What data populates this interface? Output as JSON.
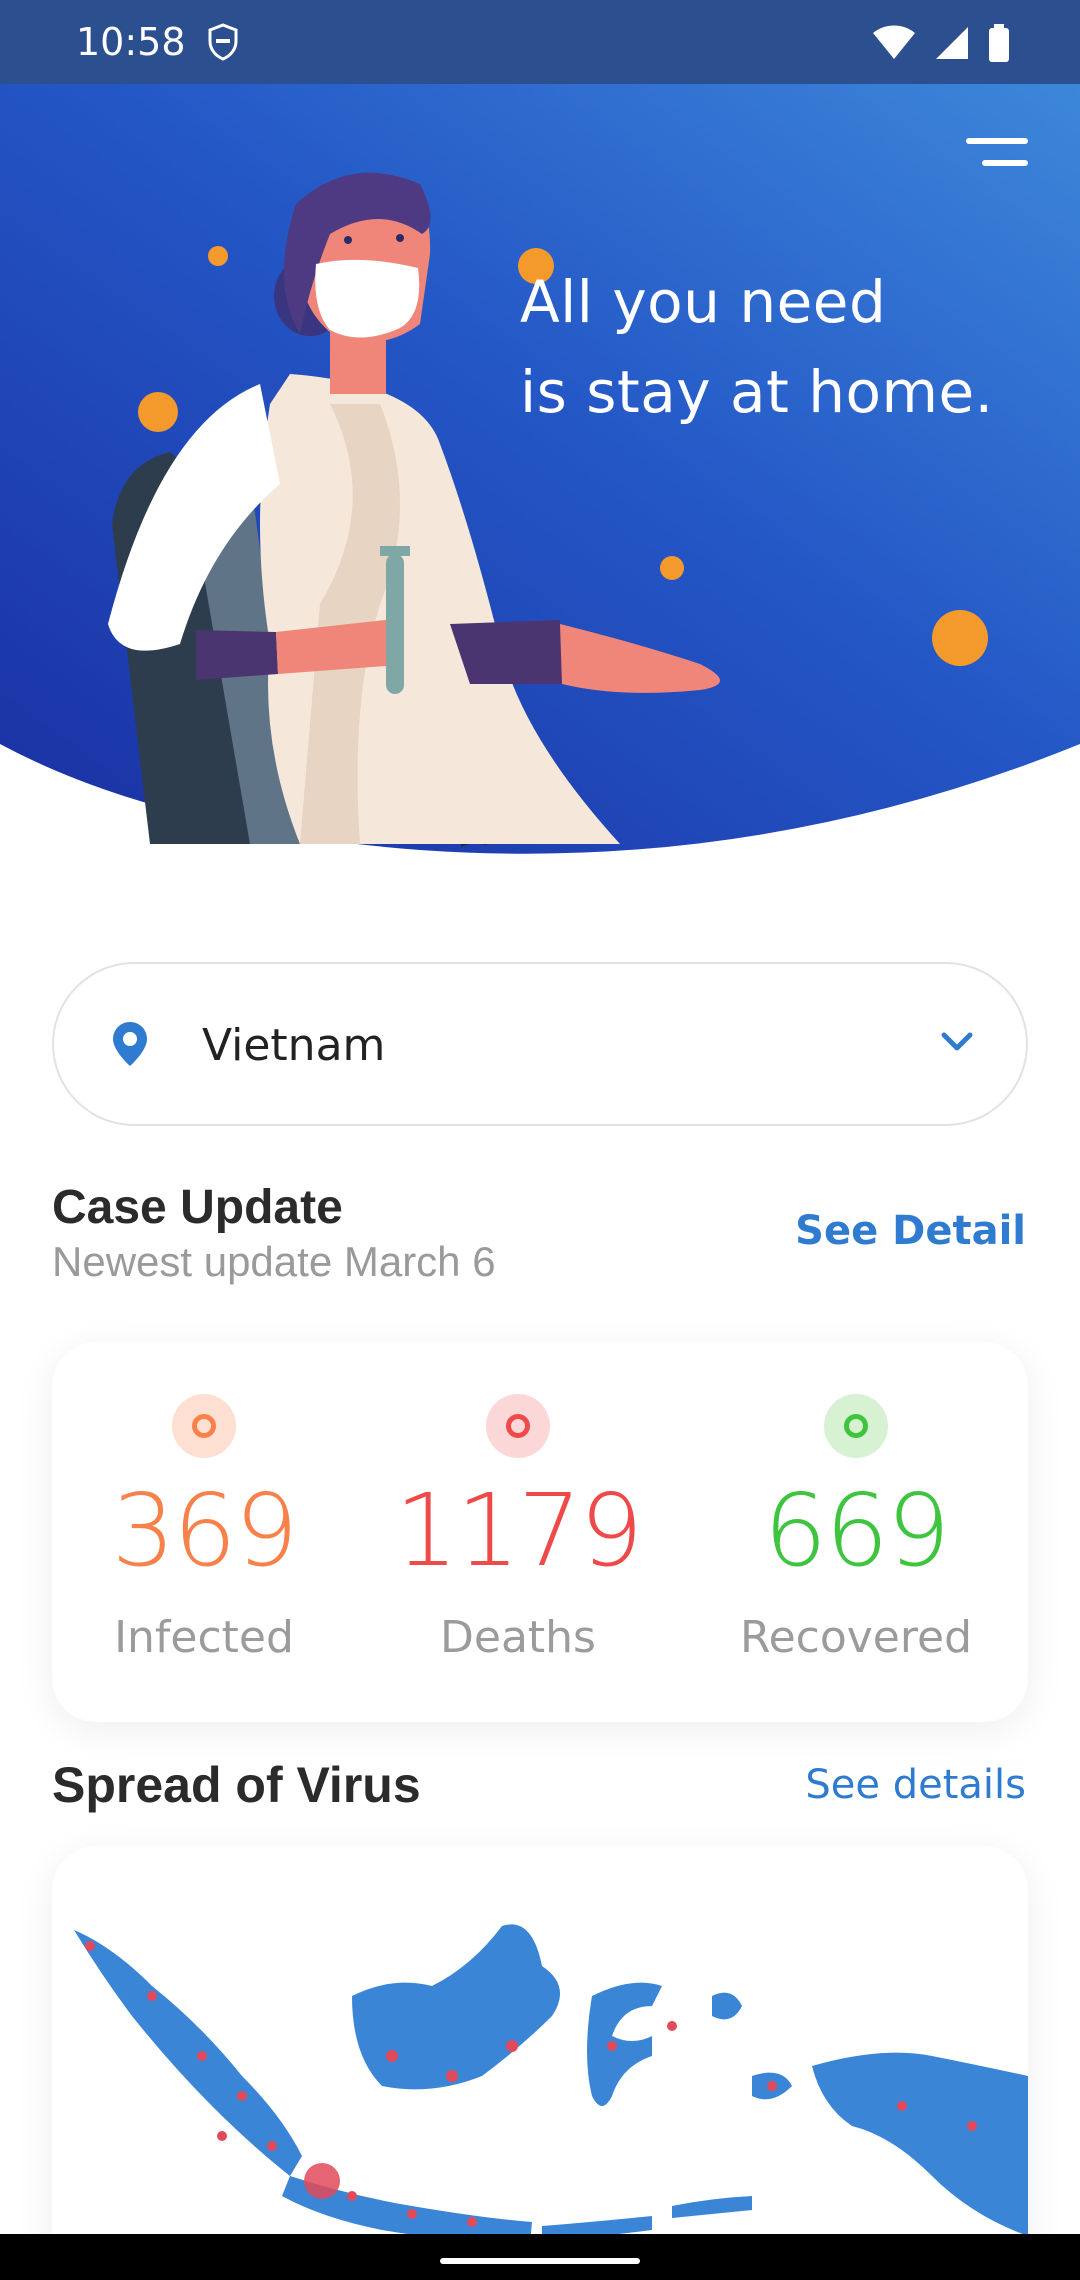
{
  "status_bar": {
    "time": "10:58"
  },
  "hero": {
    "line1": "All you need",
    "line2": "is stay at home.",
    "gradient_start": "#1b36a8",
    "gradient_end": "#3b82d8"
  },
  "location": {
    "selected": "Vietnam"
  },
  "case_update": {
    "title": "Case Update",
    "subtitle": "Newest update March 6",
    "link": "See Detail",
    "stats": [
      {
        "value": "369",
        "label": "Infected",
        "color": "#f6814a",
        "dot_bg": "#fde0d2"
      },
      {
        "value": "1179",
        "label": "Deaths",
        "color": "#ef4a4a",
        "dot_bg": "#fbd7d7"
      },
      {
        "value": "669",
        "label": "Recovered",
        "color": "#3ec43e",
        "dot_bg": "#d6f2d3"
      }
    ]
  },
  "spread": {
    "title": "Spread of Virus",
    "link": "See details",
    "map_color": "#3a85d6",
    "marker_color": "#e24a5b"
  },
  "icons": {
    "menu": "menu-icon",
    "location": "pin-icon",
    "dropdown": "chevron-down-icon",
    "wifi": "wifi-icon",
    "signal": "signal-icon",
    "battery": "battery-icon"
  }
}
